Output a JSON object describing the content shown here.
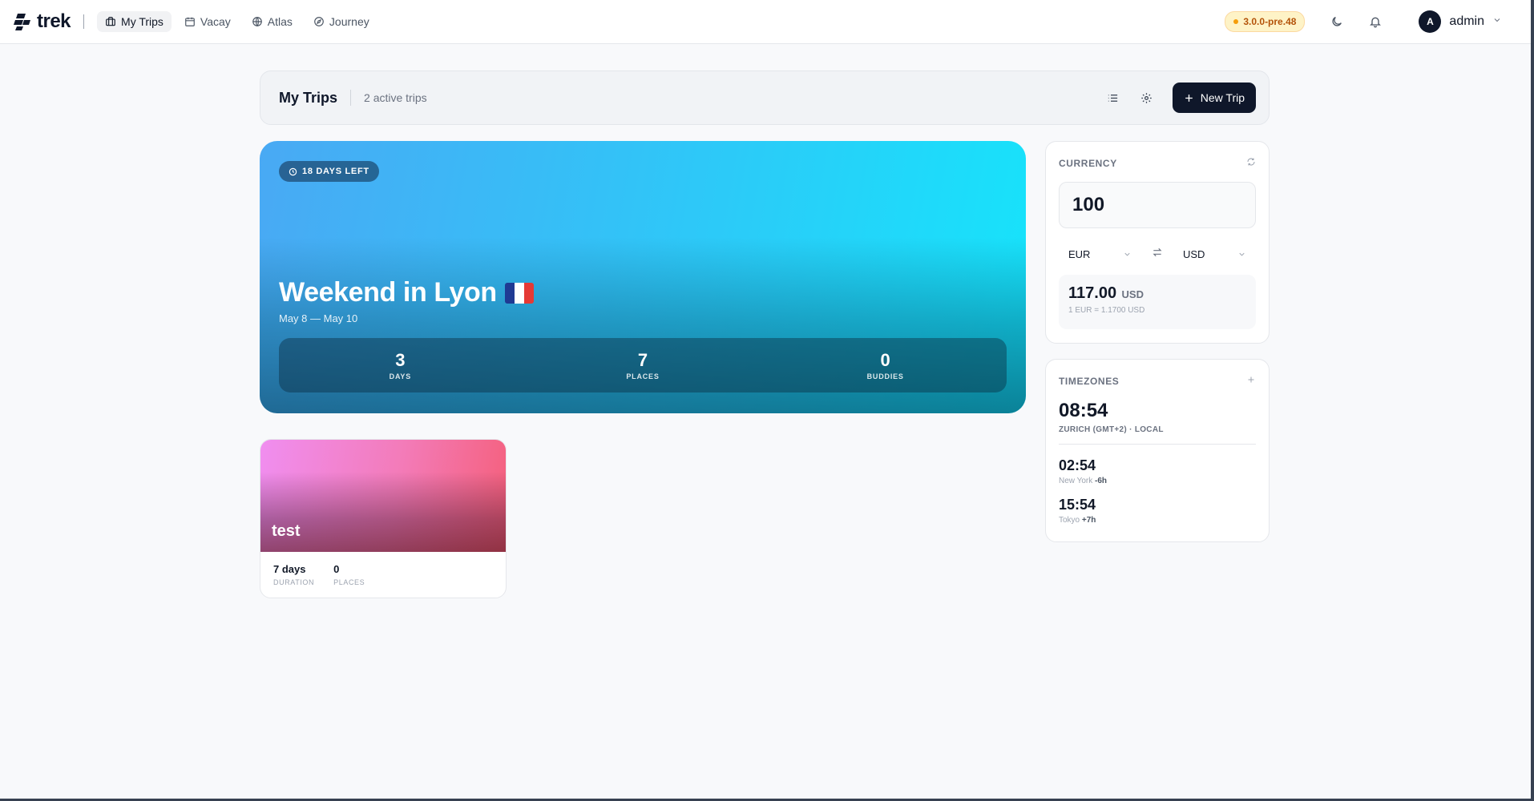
{
  "brand": {
    "name": "trek"
  },
  "nav": {
    "links": [
      {
        "label": "My Trips",
        "icon": "briefcase-icon",
        "active": true
      },
      {
        "label": "Vacay",
        "icon": "calendar-icon"
      },
      {
        "label": "Atlas",
        "icon": "globe-icon"
      },
      {
        "label": "Journey",
        "icon": "compass-icon"
      }
    ]
  },
  "topbar": {
    "version": "3.0.0-pre.48",
    "user": {
      "initial": "A",
      "name": "admin"
    }
  },
  "page": {
    "title": "My Trips",
    "trip_count": "2 active trips",
    "new_trip_label": "New Trip"
  },
  "featured_trip": {
    "badge": "18 DAYS LEFT",
    "title": "Weekend in Lyon",
    "flag": "france-flag",
    "dates": "May 8 — May 10",
    "stats": [
      {
        "value": "3",
        "label": "DAYS"
      },
      {
        "value": "7",
        "label": "PLACES"
      },
      {
        "value": "0",
        "label": "BUDDIES"
      }
    ]
  },
  "trip_card": {
    "name": "test",
    "stats": [
      {
        "value": "7 days",
        "label": "DURATION"
      },
      {
        "value": "0",
        "label": "PLACES"
      }
    ]
  },
  "currency": {
    "title": "CURRENCY",
    "amount": "100",
    "from": "EUR",
    "to": "USD",
    "result_value": "117.00",
    "result_unit": "USD",
    "rate": "1 EUR = 1.1700 USD"
  },
  "timezones": {
    "title": "TIMEZONES",
    "local": {
      "time": "08:54",
      "label": "ZURICH (GMT+2) · LOCAL"
    },
    "items": [
      {
        "time": "02:54",
        "city": "New York",
        "offset": "-6h"
      },
      {
        "time": "15:54",
        "city": "Tokyo",
        "offset": "+7h"
      }
    ]
  },
  "colors": {
    "primary": "#0f172a",
    "hero_gradient_start": "#49a9f4",
    "hero_gradient_end": "#16e4fb",
    "card_gradient_start": "#f08ef0",
    "card_gradient_end": "#f45f7a",
    "version_badge": "#b45309"
  }
}
